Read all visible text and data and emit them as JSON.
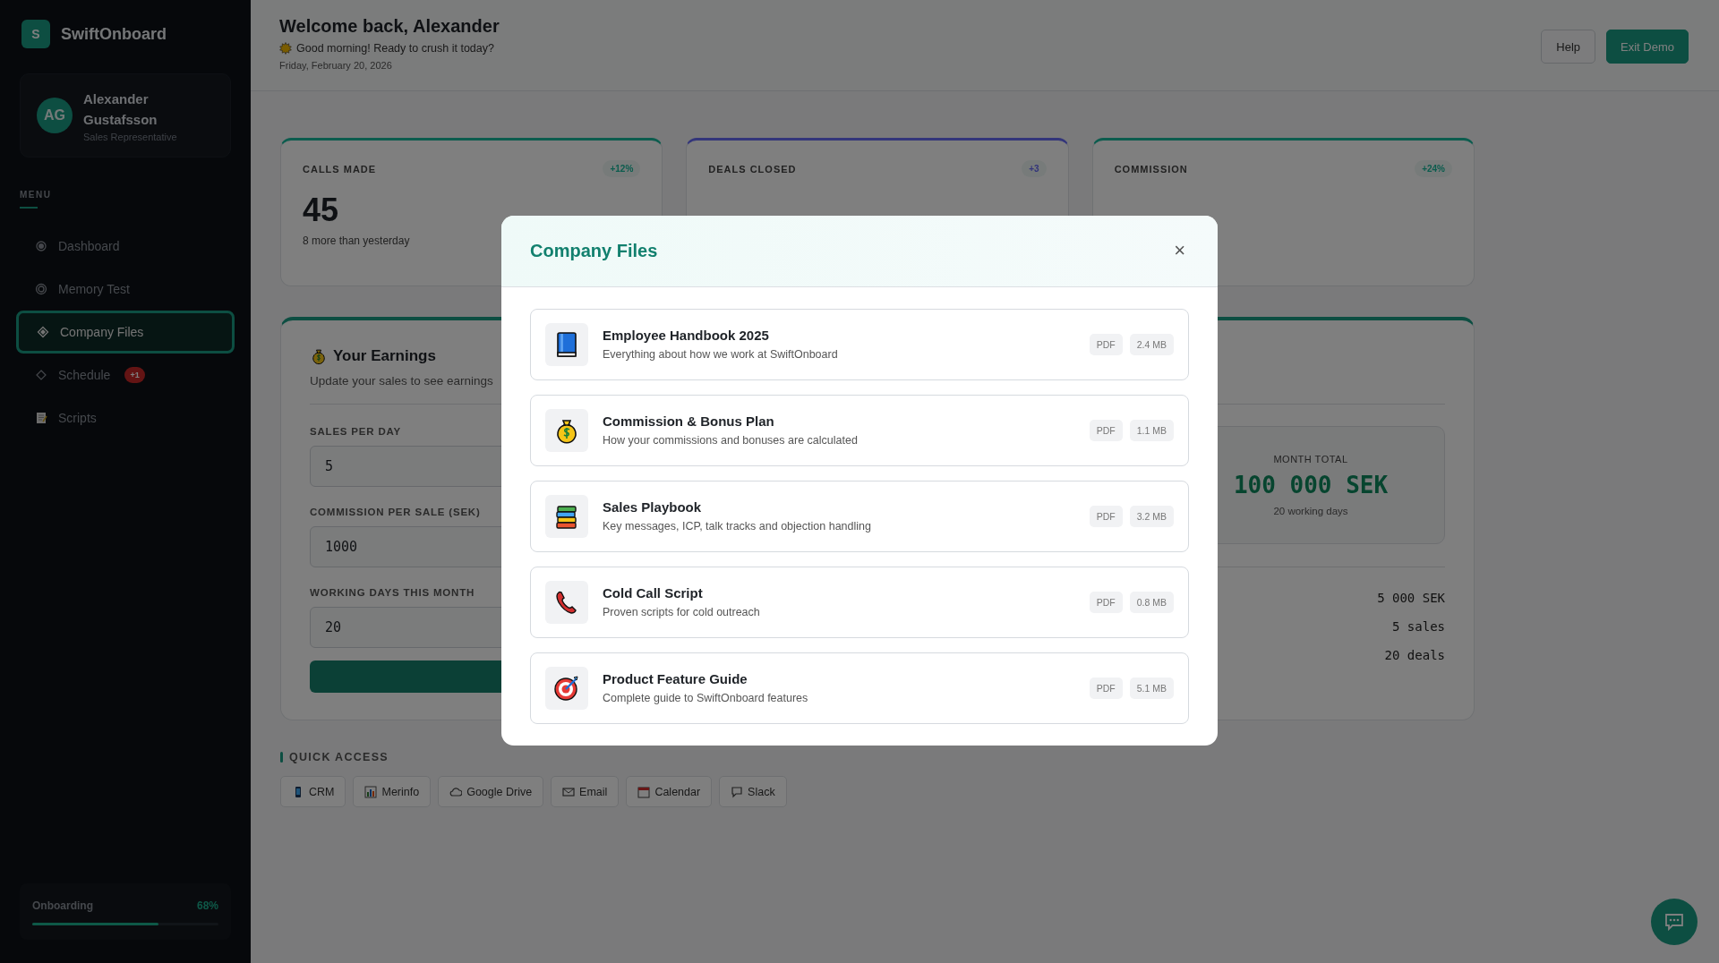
{
  "sidebar": {
    "logo_letter": "S",
    "brand": "SwiftOnboard",
    "profile": {
      "initials": "AG",
      "name": "Alexander Gustafsson",
      "role": "Sales Representative"
    },
    "menu_label": "MENU",
    "items": [
      {
        "label": "Dashboard",
        "selected": false
      },
      {
        "label": "Memory Test",
        "selected": false
      },
      {
        "label": "Company Files",
        "selected": true
      },
      {
        "label": "Schedule",
        "selected": false,
        "badge": "+1"
      },
      {
        "label": "Scripts",
        "selected": false
      }
    ],
    "onboarding": {
      "label": "Onboarding",
      "value": "68%",
      "level": 0.68
    }
  },
  "header": {
    "title": "Welcome back, Alexander",
    "greeting": "Good morning! Ready to crush it today?",
    "date": "Friday, February 20, 2026",
    "buttons": [
      {
        "label": "Help",
        "kind": "secondary"
      },
      {
        "label": "Exit Demo",
        "kind": "primary"
      }
    ]
  },
  "stats": [
    {
      "label": "CALLS MADE",
      "change": "+12%",
      "value": "45",
      "note": "8 more than yesterday",
      "color": "#0c5c4e"
    },
    {
      "label": "DEALS CLOSED",
      "change": "+3",
      "color": "#33357a"
    },
    {
      "label": "COMMISSION",
      "change": "+24%",
      "color": "#0c5c4e"
    }
  ],
  "earnings": {
    "title": "Your Earnings",
    "subtitle": "Update your sales to see earnings",
    "fields": [
      {
        "label": "SALES PER DAY",
        "value": "5"
      },
      {
        "label": "COMMISSION PER SALE (SEK)",
        "value": "1000"
      },
      {
        "label": "WORKING DAYS THIS MONTH",
        "value": "20"
      }
    ],
    "total": {
      "label": "MONTH TOTAL",
      "value": "100 000 SEK",
      "note": "20 working days"
    },
    "rows": [
      "5 000 SEK",
      "5 sales",
      "20 deals"
    ]
  },
  "quick_access": {
    "title": "QUICK ACCESS",
    "links": [
      "CRM",
      "Merinfo",
      "Google Drive",
      "Email",
      "Calendar",
      "Slack"
    ]
  },
  "modal": {
    "title": "Company Files",
    "close": "×",
    "files": [
      {
        "title": "Employee Handbook 2025",
        "description": "Everything about how we work at SwiftOnboard",
        "type": "PDF",
        "size": "2.4 MB"
      },
      {
        "title": "Commission & Bonus Plan",
        "description": "How your commissions and bonuses are calculated",
        "type": "PDF",
        "size": "1.1 MB"
      },
      {
        "title": "Sales Playbook",
        "description": "Key messages, ICP, talk tracks and objection handling",
        "type": "PDF",
        "size": "3.2 MB"
      },
      {
        "title": "Cold Call Script",
        "description": "Proven scripts for cold outreach",
        "type": "PDF",
        "size": "0.8 MB"
      },
      {
        "title": "Product Feature Guide",
        "description": "Complete guide to SwiftOnboard features",
        "type": "PDF",
        "size": "5.1 MB"
      }
    ]
  }
}
